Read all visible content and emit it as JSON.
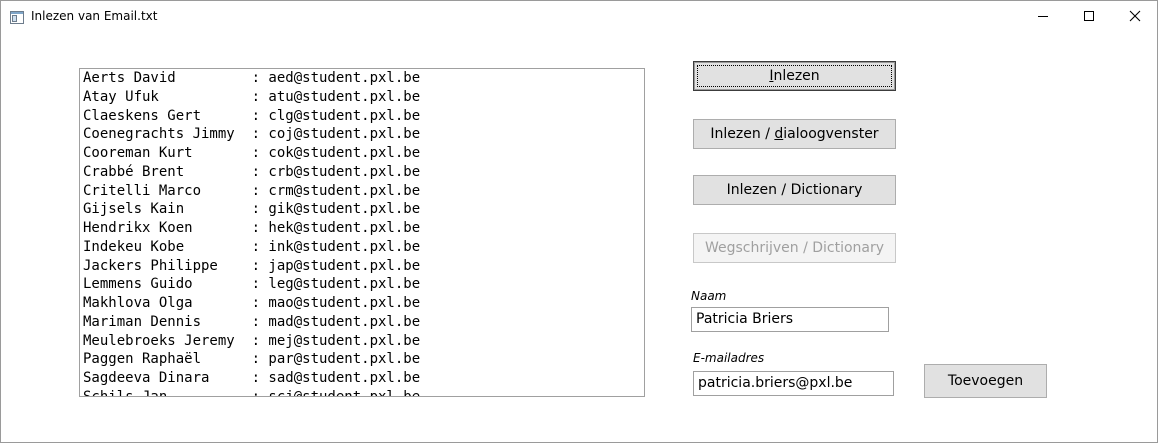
{
  "window": {
    "title": "Inlezen van Email.txt",
    "icon": "window-app-icon",
    "controls": [
      "minimize-icon",
      "maximize-icon",
      "close-icon"
    ]
  },
  "list": {
    "items": [
      "Aerts David         : aed@student.pxl.be",
      "Atay Ufuk           : atu@student.pxl.be",
      "Claeskens Gert      : clg@student.pxl.be",
      "Coenegrachts Jimmy  : coj@student.pxl.be",
      "Cooreman Kurt       : cok@student.pxl.be",
      "Crabbé Brent        : crb@student.pxl.be",
      "Critelli Marco      : crm@student.pxl.be",
      "Gijsels Kain        : gik@student.pxl.be",
      "Hendrikx Koen       : hek@student.pxl.be",
      "Indekeu Kobe        : ink@student.pxl.be",
      "Jackers Philippe    : jap@student.pxl.be",
      "Lemmens Guido       : leg@student.pxl.be",
      "Makhlova Olga       : mao@student.pxl.be",
      "Mariman Dennis      : mad@student.pxl.be",
      "Meulebroeks Jeremy  : mej@student.pxl.be",
      "Paggen Raphaël      : par@student.pxl.be",
      "Sagdeeva Dinara     : sad@student.pxl.be",
      "Schils Jan          : scj@student.pxl.be"
    ]
  },
  "buttons": {
    "inlezen": {
      "access": "I",
      "rest": "nlezen"
    },
    "dialoog": {
      "pre": "Inlezen / ",
      "access": "d",
      "rest": "ialoogvenster"
    },
    "dictionary": {
      "label": "Inlezen / Dictionary"
    },
    "wegschrijven": {
      "label": "Wegschrijven / Dictionary",
      "disabled": true
    },
    "toevoegen": {
      "label": "Toevoegen"
    }
  },
  "form": {
    "naam_label": "Naam",
    "naam_value": "Patricia Briers",
    "email_label": "E-mailadres",
    "email_value": "patricia.briers@pxl.be"
  }
}
